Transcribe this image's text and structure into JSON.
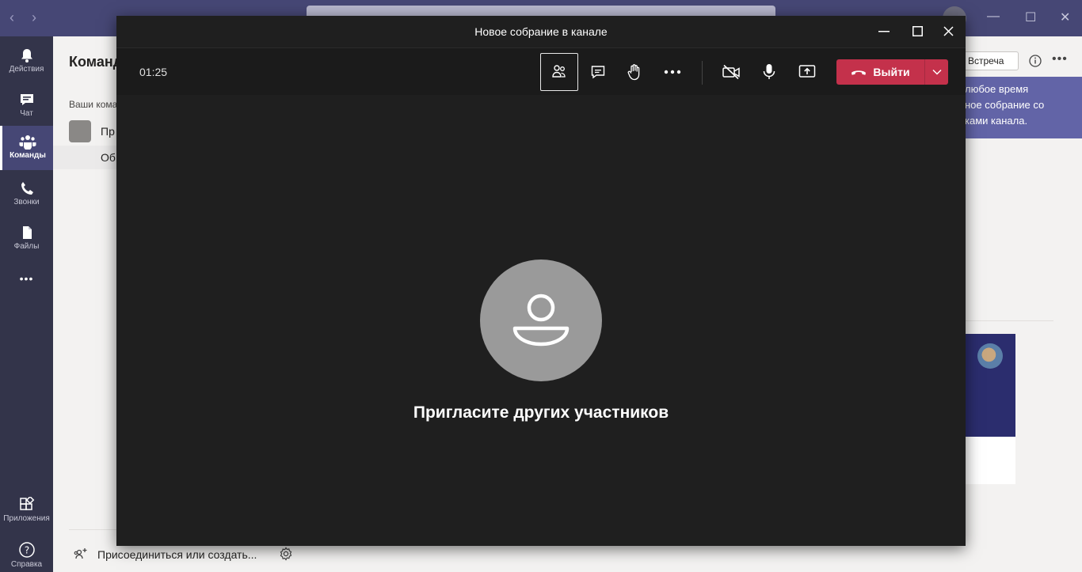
{
  "rail": {
    "items": [
      {
        "label": "Действия",
        "icon": "bell-icon"
      },
      {
        "label": "Чат",
        "icon": "chat-icon"
      },
      {
        "label": "Команды",
        "icon": "teams-icon",
        "active": true
      },
      {
        "label": "Звонки",
        "icon": "phone-icon"
      },
      {
        "label": "Файлы",
        "icon": "file-icon"
      }
    ],
    "more": "•••",
    "apps_label": "Приложения",
    "help_label": "Справка"
  },
  "teams_pane": {
    "title": "Команд",
    "subtitle": "Ваши кома",
    "team_name": "Пр",
    "channel_name": "Об",
    "join_label": "Присоединиться или создать..."
  },
  "right": {
    "meet_label": "Встреча",
    "more": "•••",
    "tooltip_lines": [
      "любое время",
      "ное собрание со",
      "ками канала."
    ]
  },
  "meeting": {
    "title": "Новое собрание в канале",
    "timer": "01:25",
    "leave_label": "Выйти",
    "invite_text": "Пригласите других участников"
  },
  "colors": {
    "teams_purple": "#464775",
    "rail_dark": "#33344a",
    "leave_red": "#c4314b",
    "tooltip": "#6264a7",
    "meeting_bg": "#1f1f1f"
  }
}
